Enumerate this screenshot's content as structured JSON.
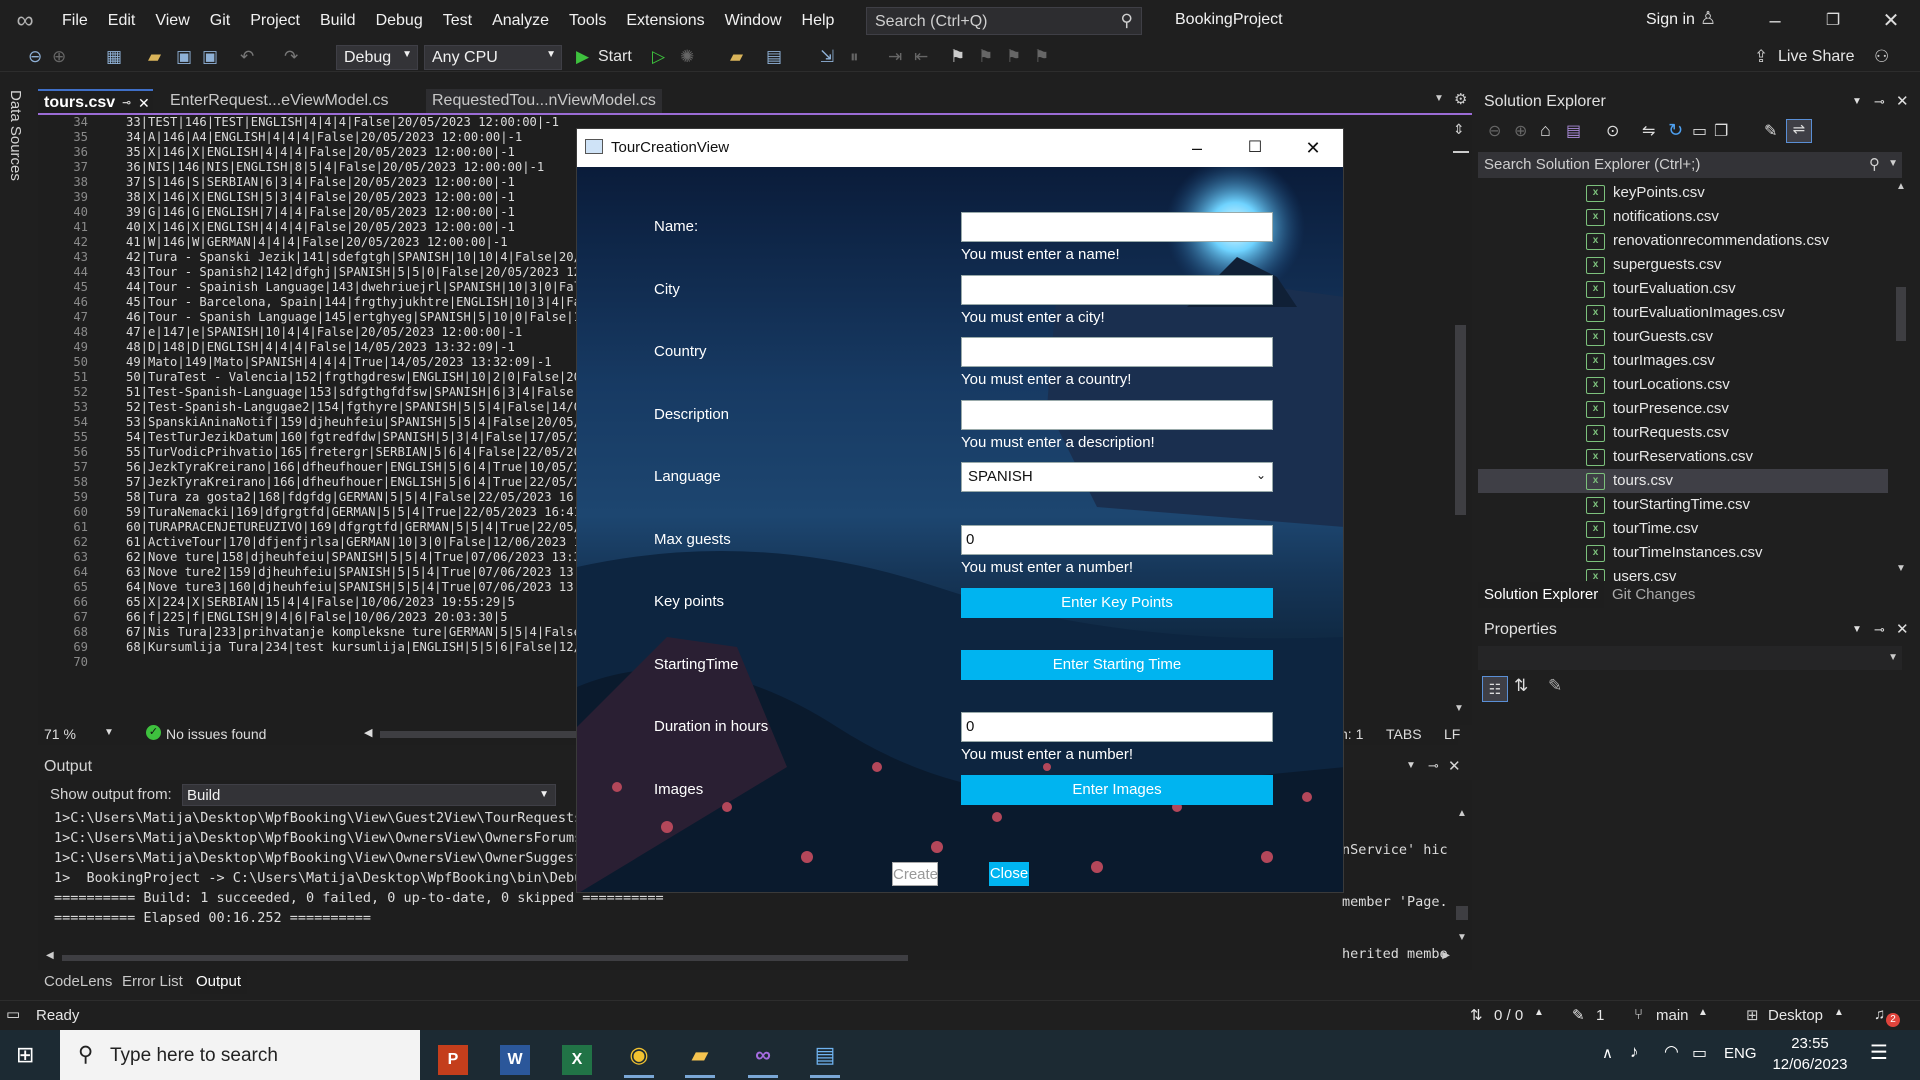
{
  "titlebar": {
    "menu": [
      "File",
      "Edit",
      "View",
      "Git",
      "Project",
      "Build",
      "Debug",
      "Test",
      "Analyze",
      "Tools",
      "Extensions",
      "Window",
      "Help"
    ],
    "search_placeholder": "Search (Ctrl+Q)",
    "project_name": "BookingProject",
    "sign_in": "Sign in",
    "live_share": "Live Share"
  },
  "toolbar": {
    "config": "Debug",
    "platform": "Any CPU",
    "start": "Start"
  },
  "left_strip": {
    "data_sources": "Data Sources"
  },
  "editor": {
    "tabs": [
      {
        "label": "tours.csv",
        "active": true
      },
      {
        "label": "EnterRequest...eViewModel.cs",
        "active": false
      },
      {
        "label": "RequestedTou...nViewModel.cs",
        "active": false
      }
    ],
    "first_line_number": 34,
    "lines": [
      "33|TEST|146|TEST|ENGLISH|4|4|4|False|20/05/2023 12:00:00|-1",
      "34|A|146|A4|ENGLISH|4|4|4|False|20/05/2023 12:00:00|-1",
      "35|X|146|X|ENGLISH|4|4|4|False|20/05/2023 12:00:00|-1",
      "36|NIS|146|NIS|ENGLISH|8|5|4|False|20/05/2023 12:00:00|-1",
      "37|S|146|S|SERBIAN|6|3|4|False|20/05/2023 12:00:00|-1",
      "38|X|146|X|ENGLISH|5|3|4|False|20/05/2023 12:00:00|-1",
      "39|G|146|G|ENGLISH|7|4|4|False|20/05/2023 12:00:00|-1",
      "40|X|146|X|ENGLISH|4|4|4|False|20/05/2023 12:00:00|-1",
      "41|W|146|W|GERMAN|4|4|4|False|20/05/2023 12:00:00|-1",
      "42|Tura - Spanski Jezik|141|sdefgtgh|SPANISH|10|10|4|False|20/05/2",
      "43|Tour - Spanish2|142|dfghj|SPANISH|5|5|0|False|20/05/2023 12:00:0",
      "44|Tour - Spainish Language|143|dwehriuejrl|SPANISH|10|3|0|False|20",
      "45|Tour - Barcelona, Spain|144|frgthyjukhtre|ENGLISH|10|3|4|False|1",
      "46|Tour - Spanish Language|145|ertghyeg|SPANISH|5|10|0|False|14/05/",
      "47|e|147|e|SPANISH|10|4|4|False|20/05/2023 12:00:00|-1",
      "48|D|148|D|ENGLISH|4|4|4|False|14/05/2023 13:32:09|-1",
      "49|Mato|149|Mato|SPANISH|4|4|4|True|14/05/2023 13:32:09|-1",
      "50|TuraTest - Valencia|152|frgthgdresw|ENGLISH|10|2|0|False|20/05/2",
      "51|Test-Spanish-Language|153|sdfgthgfdfsw|SPANISH|6|3|4|False|14/05",
      "52|Test-Spanish-Langugae2|154|fgthyre|SPANISH|5|5|4|False|14/05/202",
      "53|SpanskiAninaNotif|159|djheuhfeiu|SPANISH|5|5|4|False|20/05/2023",
      "54|TestTurJezikDatum|160|fgtredfdw|SPANISH|5|3|4|False|17/05/2023 1",
      "55|TurVodicPrihvatio|165|fretergr|SERBIAN|5|6|4|False|22/05/2023 14",
      "56|JezkTyraKreirano|166|dfheufhouer|ENGLISH|5|6|4|True|10/05/2023 1",
      "57|JezkTyraKreirano|166|dfheufhouer|ENGLISH|5|6|4|True|22/05/2023 1",
      "58|Tura za gosta2|168|fdgfdg|GERMAN|5|5|4|False|22/05/2023 16:38:40",
      "59|TuraNemacki|169|dfgrgtfd|GERMAN|5|5|4|True|22/05/2023 16:41:18|-",
      "60|TURAPRACENJETUREUZIVO|169|dfgrgtfd|GERMAN|5|5|4|True|22/05/2023 1",
      "61|ActiveTour|170|dfjenfjrlsa|GERMAN|10|3|0|False|12/06/2023 15:00:",
      "62|Nove ture|158|djheuhfeiu|SPANISH|5|5|4|True|07/06/2023 13:32:09|",
      "63|Nove ture2|159|djheuhfeiu|SPANISH|5|5|4|True|07/06/2023 13:32:09|",
      "64|Nove ture3|160|djheuhfeiu|SPANISH|5|5|4|True|07/06/2023 13:32:09|",
      "65|X|224|X|SERBIAN|15|4|4|False|10/06/2023 19:55:29|5",
      "66|f|225|f|ENGLISH|9|4|6|False|10/06/2023 20:03:30|5",
      "67|Nis Tura|233|prihvatanje kompleksne ture|GERMAN|5|5|4|False|12/0",
      "68|Kursumlija Tura|234|test kursumlija|ENGLISH|5|5|6|False|12/06/20",
      ""
    ],
    "zoom": "71 %",
    "issues": "No issues found",
    "cursor_col": "h: 1",
    "tabs_mode": "TABS",
    "line_ending": "LF"
  },
  "output": {
    "title": "Output",
    "show_from_label": "Show output from:",
    "source": "Build",
    "lines": [
      "1>C:\\Users\\Matija\\Desktop\\WpfBooking\\View\\Guest2View\\TourRequests",
      "1>C:\\Users\\Matija\\Desktop\\WpfBooking\\View\\OwnersView\\OwnersForums",
      "1>C:\\Users\\Matija\\Desktop\\WpfBooking\\View\\OwnersView\\OwnerSuggest",
      "1>  BookingProject -> C:\\Users\\Matija\\Desktop\\WpfBooking\\bin\\Debu",
      "========== Build: 1 succeeded, 0 failed, 0 up-to-date, 0 skipped ==========",
      "========== Elapsed 00:16.252 =========="
    ],
    "right_fragments": [
      "nService' hic",
      "member 'Page.",
      "herited membe"
    ],
    "bottom_tabs": [
      "CodeLens",
      "Error List",
      "Output"
    ]
  },
  "solution_explorer": {
    "title": "Solution Explorer",
    "search_placeholder": "Search Solution Explorer (Ctrl+;)",
    "files": [
      "keyPoints.csv",
      "notifications.csv",
      "renovationrecommendations.csv",
      "superguests.csv",
      "tourEvaluation.csv",
      "tourEvaluationImages.csv",
      "tourGuests.csv",
      "tourImages.csv",
      "tourLocations.csv",
      "tourPresence.csv",
      "tourRequests.csv",
      "tourReservations.csv",
      "tours.csv",
      "tourStartingTime.csv",
      "tourTime.csv",
      "tourTimeInstances.csv",
      "users.csv"
    ],
    "selected_file": "tours.csv",
    "tabs": [
      "Solution Explorer",
      "Git Changes"
    ]
  },
  "properties": {
    "title": "Properties"
  },
  "statusbar": {
    "ready": "Ready",
    "git_changes": "0 / 0",
    "pencil_count": "1",
    "branch": "main",
    "target": "Desktop",
    "notif_count": "2"
  },
  "taskbar": {
    "search_placeholder": "Type here to search",
    "lang": "ENG",
    "time": "23:55",
    "date": "12/06/2023"
  },
  "dialog": {
    "title": "TourCreationView",
    "fields": {
      "name_label": "Name:",
      "name_error": "You must enter a name!",
      "city_label": "City",
      "city_error": "You must enter a city!",
      "country_label": "Country",
      "country_error": "You must enter a country!",
      "description_label": "Description",
      "description_error": "You must enter a description!",
      "language_label": "Language",
      "language_value": "SPANISH",
      "max_guests_label": "Max guests",
      "max_guests_value": "0",
      "max_guests_error": "You must enter a number!",
      "key_points_label": "Key points",
      "key_points_button": "Enter Key Points",
      "starting_time_label": "StartingTime",
      "starting_time_button": "Enter Starting Time",
      "duration_label": "Duration in hours",
      "duration_value": "0",
      "duration_error": "You must enter a number!",
      "images_label": "Images",
      "images_button": "Enter Images",
      "create_button": "Create",
      "close_button": "Close"
    }
  },
  "colors": {
    "accent": "#00b4f0",
    "vs_purple": "#9b6cd6",
    "green_icon": "#7cc17c"
  }
}
